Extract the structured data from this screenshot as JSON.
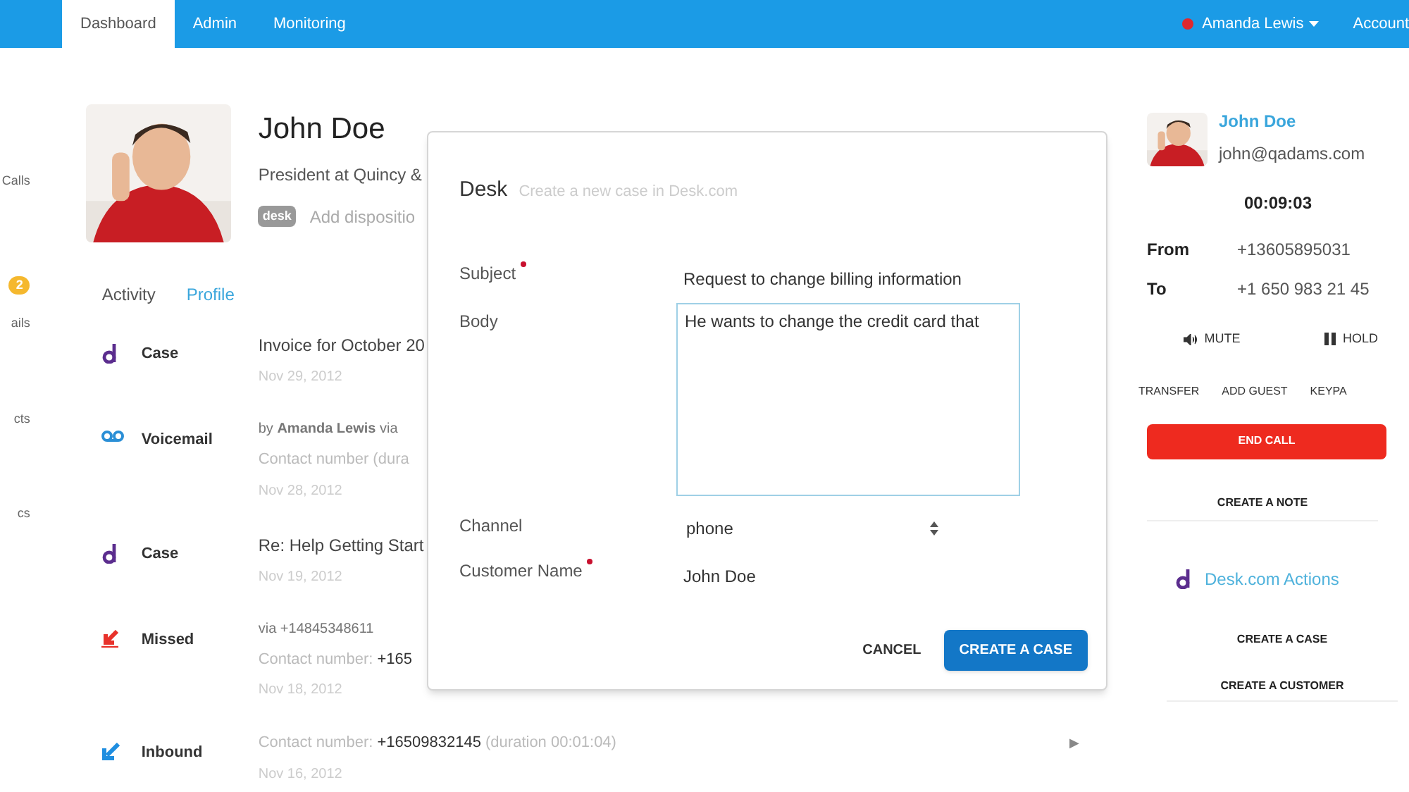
{
  "nav": {
    "tabs": [
      {
        "label": "Dashboard",
        "selected": true
      },
      {
        "label": "Admin",
        "selected": false
      },
      {
        "label": "Monitoring",
        "selected": false
      }
    ],
    "user": {
      "name": "Amanda Lewis",
      "color": "#e0282e"
    },
    "account": "Account"
  },
  "sidebar": {
    "items": [
      {
        "label": "Calls"
      },
      {
        "badge": "2"
      },
      {
        "label": "ails"
      },
      {
        "label": "cts"
      },
      {
        "label": "cs"
      }
    ]
  },
  "contact": {
    "name": "John Doe",
    "title": "President at Quincy &",
    "badge": "desk",
    "disposition": "Add dispositio"
  },
  "tabs": [
    {
      "label": "Activity",
      "selected": false
    },
    {
      "label": "Profile",
      "selected": true
    }
  ],
  "activities": [
    {
      "kind": "case",
      "label": "Case",
      "title": "Invoice for October 20",
      "date": "Nov 29, 2012"
    },
    {
      "kind": "voicemail",
      "label": "Voicemail",
      "via": "by **Amanda Lewis** via",
      "contact": "Contact number (dura",
      "date": "Nov 28, 2012"
    },
    {
      "kind": "case",
      "label": "Case",
      "title": "Re: Help Getting Start",
      "date": "Nov 19, 2012"
    },
    {
      "kind": "missed",
      "label": "Missed",
      "via": "via +14845348611",
      "contact": "Contact number: **+165**",
      "date": "Nov 18, 2012"
    },
    {
      "kind": "inbound",
      "label": "Inbound",
      "play": "▶",
      "contact": "Contact number: **+16509832145** (duration 00:01:04)",
      "date": "Nov 16, 2012"
    }
  ],
  "modal": {
    "title": "Desk",
    "subtitle": "Create a new case in Desk.com",
    "fields": [
      {
        "kind": "text",
        "label": "Subject",
        "required": true,
        "value": "Request to change billing information"
      },
      {
        "kind": "textarea",
        "label": "Body",
        "required": false,
        "value": "He wants to change the credit card that"
      },
      {
        "kind": "select",
        "label": "Channel",
        "required": false,
        "value": "phone"
      },
      {
        "kind": "text",
        "label": "Customer Name",
        "required": true,
        "value": "John Doe"
      }
    ],
    "buttons": [
      {
        "kind": "plain",
        "label": "CANCEL"
      },
      {
        "kind": "primary",
        "label": "CREATE A CASE"
      }
    ]
  },
  "call": {
    "name": "John Doe",
    "email": "john@qadams.com",
    "timer": "00:09:03",
    "from_label": "From",
    "from": "+13605895031",
    "to_label": "To",
    "to": "+1 650 983 21 45",
    "mute": "MUTE",
    "hold": "HOLD",
    "actions": [
      "TRANSFER",
      "ADD GUEST",
      "KEYPA"
    ],
    "end": "END CALL",
    "note": "CREATE A NOTE",
    "desk_title": "Desk.com Actions",
    "desk_actions": [
      "CREATE A CASE",
      "CREATE A CUSTOMER"
    ]
  }
}
